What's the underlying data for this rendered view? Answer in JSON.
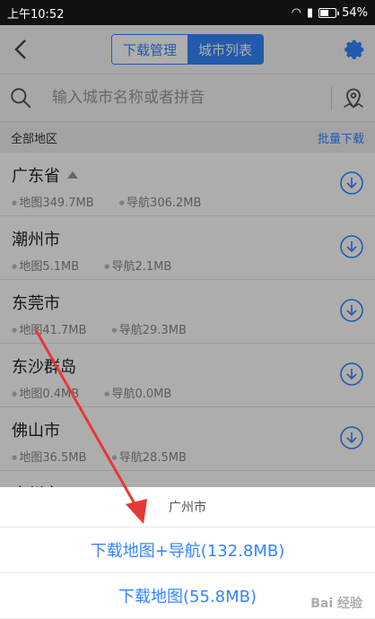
{
  "status": {
    "time": "上午10:52",
    "battery": "54%",
    "battery_level": 0.54
  },
  "header": {
    "tab_download_manage": "下载管理",
    "tab_city_list": "城市列表",
    "active_tab": "城市列表"
  },
  "search": {
    "placeholder": "输入城市名称或者拼音"
  },
  "section": {
    "title": "全部地区",
    "batch_download": "批量下载"
  },
  "cities": [
    {
      "name": "广东省",
      "map": "地图349.7MB",
      "nav": "导航306.2MB",
      "expandable": true
    },
    {
      "name": "潮州市",
      "map": "地图5.1MB",
      "nav": "导航2.1MB"
    },
    {
      "name": "东莞市",
      "map": "地图41.7MB",
      "nav": "导航29.3MB"
    },
    {
      "name": "东沙群岛",
      "map": "地图0.4MB",
      "nav": "导航0.0MB"
    },
    {
      "name": "佛山市",
      "map": "地图36.5MB",
      "nav": "导航28.5MB"
    },
    {
      "name": "广州市",
      "map": "",
      "nav": ""
    }
  ],
  "sheet": {
    "title": "广州市",
    "option_map_nav": "下载地图+导航(132.8MB)",
    "option_map": "下载地图(55.8MB)"
  },
  "watermark": "Bai 经验",
  "colors": {
    "accent": "#3385ff",
    "annotation_arrow": "#e53935"
  },
  "icons": [
    "back-arrow-icon",
    "gear-icon",
    "search-icon",
    "location-pin-icon",
    "download-circle-icon"
  ]
}
